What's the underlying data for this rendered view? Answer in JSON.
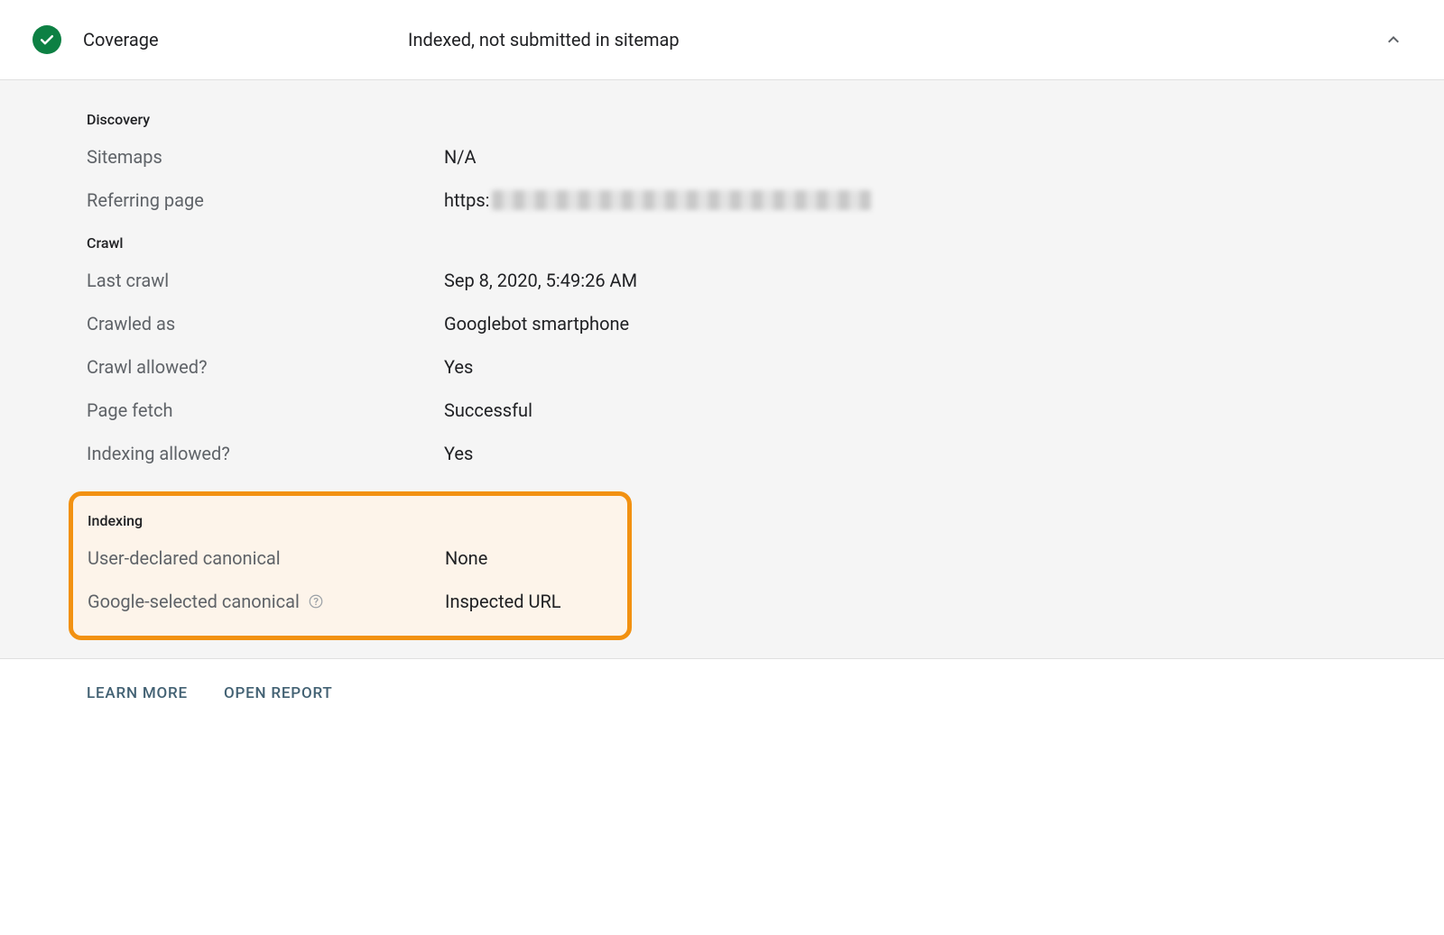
{
  "header": {
    "title": "Coverage",
    "status": "Indexed, not submitted in sitemap"
  },
  "discovery": {
    "section_label": "Discovery",
    "sitemaps": {
      "label": "Sitemaps",
      "value": "N/A"
    },
    "referring_page": {
      "label": "Referring page",
      "prefix": "https:"
    }
  },
  "crawl": {
    "section_label": "Crawl",
    "last_crawl": {
      "label": "Last crawl",
      "value": "Sep 8, 2020, 5:49:26 AM"
    },
    "crawled_as": {
      "label": "Crawled as",
      "value": "Googlebot smartphone"
    },
    "crawl_allowed": {
      "label": "Crawl allowed?",
      "value": "Yes"
    },
    "page_fetch": {
      "label": "Page fetch",
      "value": "Successful"
    },
    "indexing_allowed": {
      "label": "Indexing allowed?",
      "value": "Yes"
    }
  },
  "indexing": {
    "section_label": "Indexing",
    "user_canonical": {
      "label": "User-declared canonical",
      "value": "None"
    },
    "google_canonical": {
      "label": "Google-selected canonical",
      "value": "Inspected URL"
    }
  },
  "footer": {
    "learn_more": "Learn more",
    "open_report": "Open report"
  }
}
